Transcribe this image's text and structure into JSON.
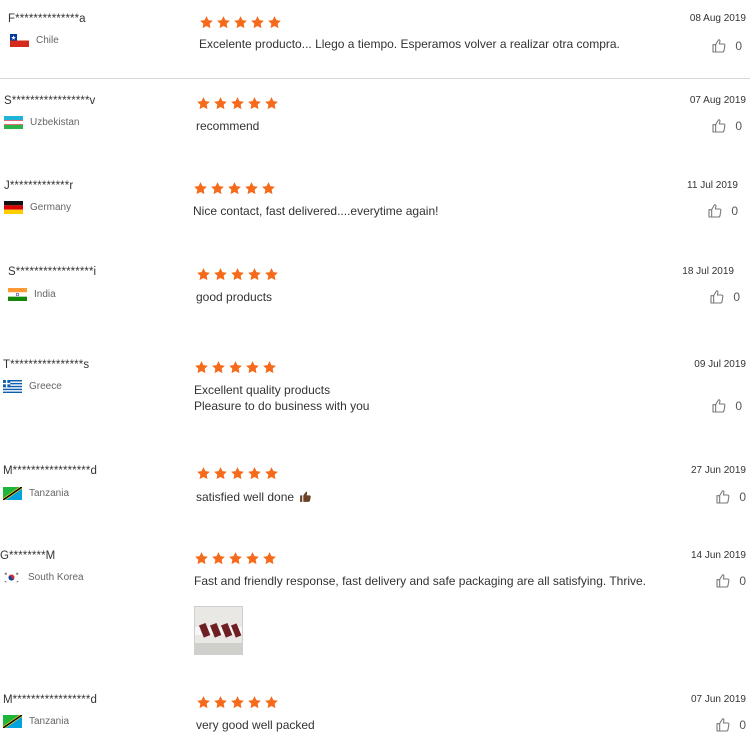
{
  "reviews": [
    {
      "user": "F**************a",
      "country": "Chile",
      "flag_icon": "chile-flag-icon",
      "rating": 5,
      "text": "Excelente producto... Llego a tiempo. Esperamos volver a realizar otra compra.",
      "date": "08 Aug 2019",
      "helpful_count": "0"
    },
    {
      "user": "S*****************v",
      "country": "Uzbekistan",
      "flag_icon": "uzbekistan-flag-icon",
      "rating": 5,
      "text": "recommend",
      "date": "07 Aug 2019",
      "helpful_count": "0"
    },
    {
      "user": "J*************r",
      "country": "Germany",
      "flag_icon": "germany-flag-icon",
      "rating": 5,
      "text": "Nice contact, fast delivered....everytime again!",
      "date": "11 Jul 2019",
      "helpful_count": "0"
    },
    {
      "user": "S*****************i",
      "country": "India",
      "flag_icon": "india-flag-icon",
      "rating": 5,
      "text": "good products",
      "date": "18 Jul 2019",
      "helpful_count": "0"
    },
    {
      "user": "T****************s",
      "country": "Greece",
      "flag_icon": "greece-flag-icon",
      "rating": 5,
      "text_line1": "Excellent quality products",
      "text_line2": "Pleasure to do business with you",
      "date": "09 Jul 2019",
      "helpful_count": "0"
    },
    {
      "user": "M*****************d",
      "country": "Tanzania",
      "flag_icon": "tanzania-flag-icon",
      "rating": 5,
      "text": "satisfied well done",
      "emoji_icon": "thumbs-up-emoji-icon",
      "date": "27 Jun 2019",
      "helpful_count": "0"
    },
    {
      "user": "G********M",
      "country": "South Korea",
      "flag_icon": "south-korea-flag-icon",
      "rating": 5,
      "text": "Fast and friendly response, fast delivery and safe packaging are all satisfying. Thrive.",
      "photo_icon": "review-photo-thumbnail",
      "date": "14 Jun 2019",
      "helpful_count": "0"
    },
    {
      "user": "M*****************d",
      "country": "Tanzania",
      "flag_icon": "tanzania-flag-icon",
      "rating": 5,
      "text": "very good well packed",
      "date": "07 Jun 2019",
      "helpful_count": "0"
    }
  ],
  "colors": {
    "star": "#f56b1b",
    "divider": "#d7d7d7",
    "text": "#333333",
    "muted": "#666666"
  },
  "icons": {
    "star": "star-icon",
    "helpful": "thumbs-up-icon"
  }
}
